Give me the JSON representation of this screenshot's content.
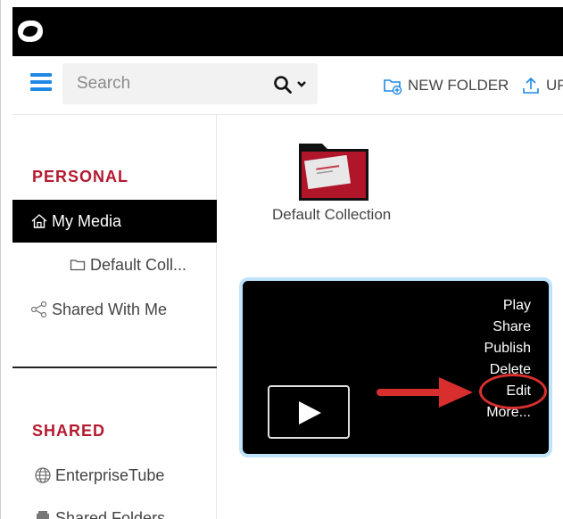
{
  "search": {
    "placeholder": "Search"
  },
  "toolbar": {
    "new_folder_label": "NEW FOLDER",
    "upload_label": "UP"
  },
  "sidebar": {
    "personal_title": "PERSONAL",
    "my_media": "My Media",
    "default_collection": "Default Coll...",
    "shared_with_me": "Shared With Me",
    "shared_title": "SHARED",
    "enterprise_tube": "EnterpriseTube",
    "shared_folders": "Shared Folders"
  },
  "main": {
    "collection_label": "Default Collection",
    "video_menu": [
      "Play",
      "Share",
      "Publish",
      "Delete",
      "Edit",
      "More..."
    ]
  },
  "colors": {
    "accent_blue": "#1e88e5",
    "section_red": "#b5192f",
    "annotation_red": "#d92e2e",
    "card_border": "#bfe3fa"
  },
  "icons": {
    "logo": "app-logo",
    "menu": "hamburger-icon",
    "search": "search-icon",
    "new_folder": "folder-plus-icon",
    "upload": "upload-icon",
    "home": "home-icon",
    "folder": "folder-icon",
    "share": "share-icon",
    "globe": "globe-icon",
    "shared_folders": "shared-folders-icon",
    "play": "play-icon"
  }
}
